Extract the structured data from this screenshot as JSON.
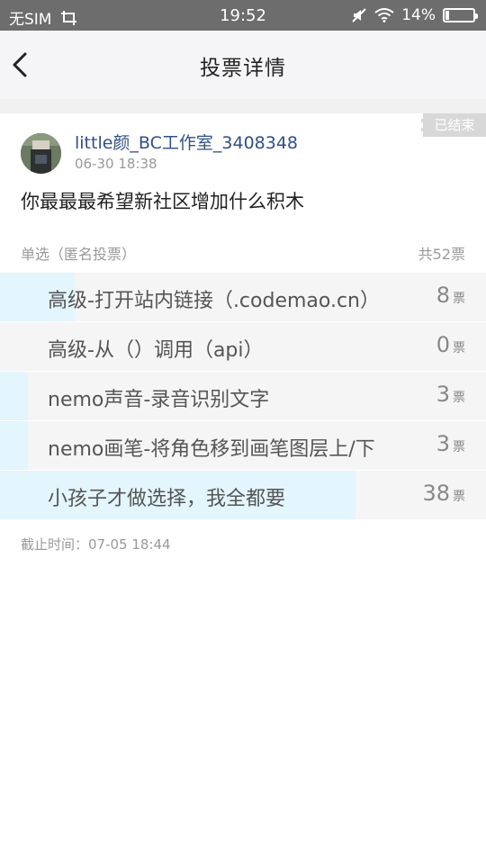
{
  "status_bar": {
    "carrier": "无SIM",
    "time": "19:52",
    "battery_percent": "14%",
    "battery_level": 0.14
  },
  "nav": {
    "title": "投票详情"
  },
  "post": {
    "ended_label": "已结束",
    "author": "little颜_BC工作室_3408348",
    "time": "06-30 18:38",
    "question": "你最最最希望新社区增加什么积木"
  },
  "vote": {
    "type_label": "单选（匿名投票）",
    "total_label": "共52票",
    "total": 52,
    "unit": "票",
    "options": [
      {
        "label": "高级-打开站内链接（.codemao.cn）",
        "count": 8
      },
      {
        "label": "高级-从（）调用（api）",
        "count": 0
      },
      {
        "label": "nemo声音-录音识别文字",
        "count": 3
      },
      {
        "label": "nemo画笔-将角色移到画笔图层上/下",
        "count": 3
      },
      {
        "label": "小孩子才做选择，我全都要",
        "count": 38
      }
    ],
    "deadline": "截止时间：07-05 18:44"
  }
}
